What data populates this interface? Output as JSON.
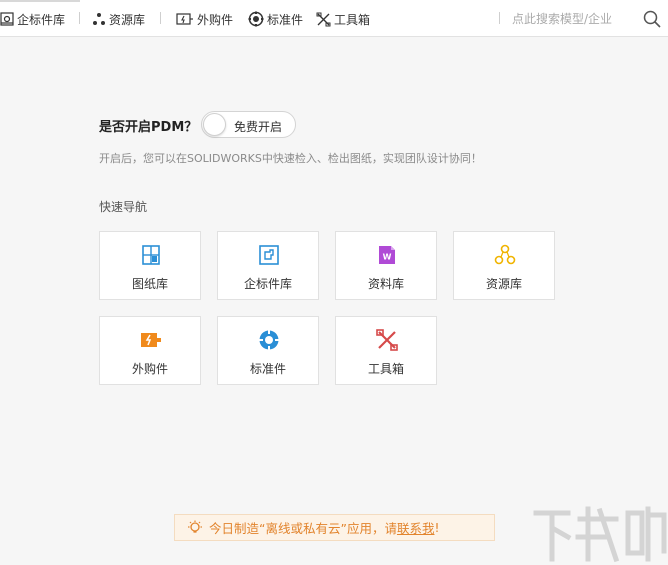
{
  "toolbar": {
    "items": [
      {
        "label": "企标件库",
        "icon": "enterprise-library-icon"
      },
      {
        "label": "资源库",
        "icon": "resource-library-icon"
      },
      {
        "label": "外购件",
        "icon": "purchased-part-icon"
      },
      {
        "label": "标准件",
        "icon": "standard-part-icon"
      },
      {
        "label": "工具箱",
        "icon": "toolbox-icon"
      }
    ],
    "search": {
      "placeholder": "点此搜索模型/企业"
    }
  },
  "pdm": {
    "title": "是否开启PDM？",
    "toggle_label": "免费开启",
    "enabled": false,
    "description": "开启后，您可以在SOLIDWORKS中快速检入、检出图纸，实现团队设计协同！"
  },
  "quick_nav": {
    "heading": "快速导航",
    "cards": [
      {
        "label": "图纸库",
        "icon": "drawing-library-icon",
        "color": "#2b8fd6"
      },
      {
        "label": "企标件库",
        "icon": "enterprise-library-icon",
        "color": "#2b8fd6"
      },
      {
        "label": "资料库",
        "icon": "document-library-icon",
        "color": "#b04ad6"
      },
      {
        "label": "资源库",
        "icon": "resource-library-icon",
        "color": "#f0b400"
      },
      {
        "label": "外购件",
        "icon": "purchased-part-icon",
        "color": "#f08a1c"
      },
      {
        "label": "标准件",
        "icon": "standard-part-icon",
        "color": "#2b8fd6"
      },
      {
        "label": "工具箱",
        "icon": "toolbox-icon",
        "color": "#d64a4a"
      }
    ]
  },
  "banner": {
    "text": "今日制造“离线或私有云”应用，请",
    "link": "联系我",
    "suffix": "!",
    "icon": "lightbulb-icon",
    "color": "#e2842d"
  },
  "watermark": {
    "text": "下载吧"
  }
}
